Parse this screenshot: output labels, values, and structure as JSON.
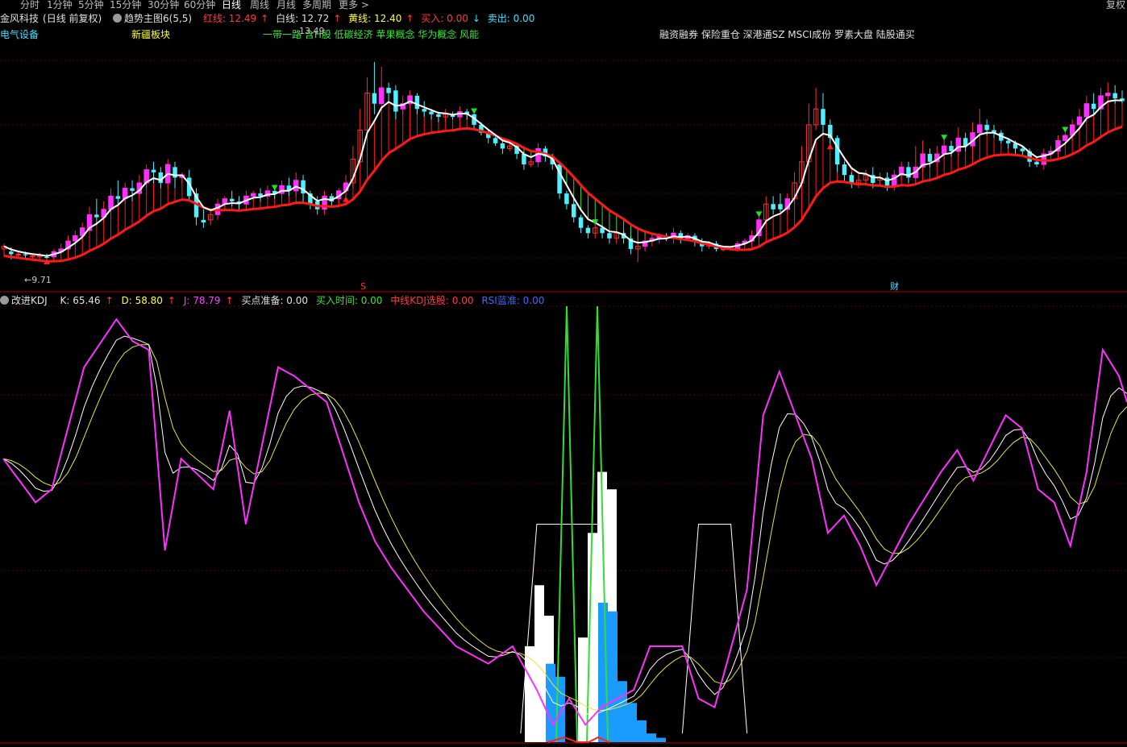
{
  "tabs": [
    "分时",
    "1分钟",
    "5分钟",
    "15分钟",
    "30分钟",
    "60分钟",
    "日线",
    "周线",
    "月线",
    "多周期",
    "更多 >"
  ],
  "active_tab": "日线",
  "corner_label": "复权",
  "stock": {
    "name": "金风科技",
    "mode": "(日线 前复权)"
  },
  "indicator1": {
    "name": "趋势主图6(5,5)",
    "red_label": "红线: 12.49",
    "white_label": "白线: 12.72",
    "yellow_label": "黄线: 12.40",
    "buy_label": "买入: 0.00",
    "sell_label": "卖出: 0.00"
  },
  "concepts": {
    "sector1": "电气设备",
    "sector2": "新疆板块",
    "themes": "一带一路 含H股 低碳经济 苹果概念 华为概念 风能",
    "themes2": "融资融券 保险重仓 深港通SZ MSCI成份 罗素大盘 陆股通买"
  },
  "chart_marks": {
    "low_label": "←9.71",
    "high_label": "13.49",
    "marker_s": "S",
    "marker_cai": "财"
  },
  "indicator2": {
    "name": "改进KDJ",
    "k_label": "K: 65.46",
    "d_label": "D: 58.80",
    "j_label": "J: 78.79",
    "prep_label": "买点准备: 0.00",
    "time_label": "买入时间: 0.00",
    "mid_label": "中线KDJ选股: 0.00",
    "rsi_label": "RSI蓝准: 0.00"
  },
  "colors": {
    "up": "#ff2d2d",
    "down": "#4ef0ff",
    "magenta": "#ff30ff",
    "red_line": "#ff1a1a",
    "white_line": "#ffffff",
    "green_fill": "#39d839",
    "blue_bar": "#1a9bff",
    "grid": "#5a0000"
  },
  "chart_data": {
    "type": "candlestick",
    "price_range": [
      9.4,
      13.9
    ],
    "candles": [
      [
        9.95,
        10.0,
        9.8,
        10.05
      ],
      [
        9.9,
        9.85,
        9.75,
        9.98
      ],
      [
        9.85,
        9.85,
        9.8,
        9.9
      ],
      [
        9.85,
        9.83,
        9.78,
        9.9
      ],
      [
        9.8,
        9.82,
        9.76,
        9.86
      ],
      [
        9.8,
        9.82,
        9.74,
        9.88
      ],
      [
        9.8,
        9.78,
        9.72,
        9.86
      ],
      [
        9.8,
        9.9,
        9.72,
        9.95
      ],
      [
        9.9,
        9.95,
        9.85,
        10.05
      ],
      [
        9.95,
        10.1,
        9.9,
        10.2
      ],
      [
        10.1,
        10.2,
        10.0,
        10.3
      ],
      [
        10.2,
        10.35,
        10.1,
        10.45
      ],
      [
        10.3,
        10.6,
        10.25,
        10.75
      ],
      [
        10.6,
        10.55,
        10.4,
        10.9
      ],
      [
        10.55,
        10.7,
        10.45,
        10.85
      ],
      [
        10.7,
        10.95,
        10.6,
        11.1
      ],
      [
        10.95,
        10.9,
        10.8,
        11.25
      ],
      [
        10.9,
        11.1,
        10.8,
        11.2
      ],
      [
        11.1,
        11.05,
        10.85,
        11.25
      ],
      [
        11.0,
        11.2,
        10.9,
        11.35
      ],
      [
        11.2,
        11.45,
        11.1,
        11.55
      ],
      [
        11.45,
        11.4,
        11.2,
        11.6
      ],
      [
        11.4,
        11.2,
        11.1,
        11.5
      ],
      [
        11.2,
        11.55,
        11.1,
        11.65
      ],
      [
        11.5,
        11.3,
        11.1,
        11.6
      ],
      [
        11.3,
        11.35,
        11.2,
        11.4
      ],
      [
        11.3,
        10.95,
        10.85,
        11.45
      ],
      [
        11.0,
        10.55,
        10.4,
        11.1
      ],
      [
        10.5,
        10.45,
        10.35,
        10.7
      ],
      [
        10.5,
        10.6,
        10.4,
        10.7
      ],
      [
        10.6,
        10.8,
        10.5,
        10.9
      ],
      [
        10.8,
        10.9,
        10.7,
        10.95
      ],
      [
        10.9,
        10.85,
        10.75,
        11.05
      ],
      [
        10.85,
        10.8,
        10.7,
        10.95
      ],
      [
        10.8,
        10.95,
        10.7,
        11.05
      ],
      [
        10.95,
        11.0,
        10.85,
        11.05
      ],
      [
        11.0,
        10.95,
        10.85,
        11.1
      ],
      [
        10.95,
        11.05,
        10.9,
        11.15
      ],
      [
        11.05,
        11.0,
        10.9,
        11.1
      ],
      [
        11.0,
        11.15,
        10.9,
        11.25
      ],
      [
        11.15,
        11.05,
        10.95,
        11.3
      ],
      [
        11.05,
        11.25,
        10.95,
        11.4
      ],
      [
        11.25,
        11.0,
        10.8,
        11.35
      ],
      [
        11.0,
        10.8,
        10.7,
        11.05
      ],
      [
        10.85,
        10.7,
        10.6,
        10.95
      ],
      [
        10.7,
        10.95,
        10.6,
        11.05
      ],
      [
        10.95,
        10.85,
        10.75,
        11.0
      ],
      [
        10.9,
        11.05,
        10.8,
        11.1
      ],
      [
        11.05,
        11.2,
        10.9,
        11.35
      ],
      [
        11.2,
        11.65,
        11.1,
        11.9
      ],
      [
        11.6,
        12.2,
        11.5,
        12.6
      ],
      [
        12.2,
        12.9,
        12.0,
        13.2
      ],
      [
        12.9,
        12.7,
        12.5,
        13.49
      ],
      [
        12.7,
        13.0,
        12.6,
        13.4
      ],
      [
        13.0,
        12.9,
        12.75,
        13.1
      ],
      [
        12.95,
        12.55,
        12.4,
        13.05
      ],
      [
        12.6,
        12.7,
        12.5,
        12.85
      ],
      [
        12.7,
        12.85,
        12.6,
        12.95
      ],
      [
        12.85,
        12.6,
        12.5,
        12.9
      ],
      [
        12.6,
        12.55,
        12.45,
        12.75
      ],
      [
        12.55,
        12.5,
        12.4,
        12.6
      ],
      [
        12.5,
        12.45,
        12.35,
        12.55
      ],
      [
        12.45,
        12.5,
        12.35,
        12.6
      ],
      [
        12.5,
        12.45,
        12.4,
        12.55
      ],
      [
        12.45,
        12.55,
        12.4,
        12.65
      ],
      [
        12.55,
        12.5,
        12.4,
        12.6
      ],
      [
        12.5,
        12.3,
        12.2,
        12.55
      ],
      [
        12.3,
        12.15,
        12.1,
        12.35
      ],
      [
        12.15,
        12.05,
        11.95,
        12.2
      ],
      [
        12.05,
        11.95,
        11.9,
        12.1
      ],
      [
        11.95,
        11.85,
        11.75,
        12.0
      ],
      [
        11.85,
        11.9,
        11.8,
        12.0
      ],
      [
        11.9,
        11.75,
        11.65,
        11.95
      ],
      [
        11.75,
        11.55,
        11.45,
        11.8
      ],
      [
        11.55,
        11.6,
        11.5,
        11.7
      ],
      [
        11.6,
        11.85,
        11.5,
        11.95
      ],
      [
        11.85,
        11.7,
        11.6,
        11.9
      ],
      [
        11.7,
        11.55,
        11.45,
        11.75
      ],
      [
        11.55,
        11.0,
        10.9,
        11.6
      ],
      [
        11.0,
        10.8,
        10.7,
        11.05
      ],
      [
        10.8,
        10.55,
        10.45,
        10.9
      ],
      [
        10.55,
        10.35,
        10.25,
        10.6
      ],
      [
        10.35,
        10.25,
        10.15,
        10.4
      ],
      [
        10.25,
        10.35,
        10.15,
        10.45
      ],
      [
        10.35,
        10.25,
        10.15,
        10.4
      ],
      [
        10.25,
        10.15,
        10.05,
        10.3
      ],
      [
        10.15,
        10.25,
        10.05,
        10.3
      ],
      [
        10.25,
        10.15,
        10.05,
        10.3
      ],
      [
        10.15,
        9.95,
        9.85,
        10.2
      ],
      [
        9.95,
        10.0,
        9.7,
        10.35
      ],
      [
        10.0,
        10.1,
        9.9,
        10.2
      ],
      [
        10.1,
        10.15,
        10.0,
        10.2
      ],
      [
        10.15,
        10.2,
        10.05,
        10.25
      ],
      [
        10.2,
        10.15,
        10.1,
        10.25
      ],
      [
        10.15,
        10.25,
        10.05,
        10.35
      ],
      [
        10.25,
        10.15,
        10.05,
        10.3
      ],
      [
        10.15,
        10.2,
        10.1,
        10.25
      ],
      [
        10.2,
        10.1,
        10.0,
        10.25
      ],
      [
        10.1,
        10.0,
        9.9,
        10.15
      ],
      [
        10.0,
        10.05,
        9.95,
        10.1
      ],
      [
        10.05,
        9.95,
        9.9,
        10.1
      ],
      [
        9.95,
        9.95,
        9.9,
        10.0
      ],
      [
        9.95,
        9.98,
        9.92,
        10.0
      ],
      [
        9.95,
        10.05,
        9.9,
        10.1
      ],
      [
        10.05,
        10.1,
        10.0,
        10.15
      ],
      [
        10.1,
        10.2,
        10.05,
        10.3
      ],
      [
        10.2,
        10.5,
        10.1,
        10.6
      ],
      [
        10.5,
        10.8,
        10.4,
        10.95
      ],
      [
        10.8,
        10.7,
        10.6,
        10.95
      ],
      [
        10.8,
        10.7,
        10.65,
        11.0
      ],
      [
        10.7,
        10.9,
        10.6,
        11.0
      ],
      [
        10.9,
        11.2,
        10.8,
        11.4
      ],
      [
        11.2,
        11.6,
        11.1,
        11.9
      ],
      [
        11.6,
        12.3,
        11.5,
        12.7
      ],
      [
        12.3,
        12.6,
        12.2,
        13.0
      ],
      [
        12.6,
        12.3,
        12.1,
        12.9
      ],
      [
        12.3,
        12.05,
        11.9,
        12.4
      ],
      [
        12.05,
        11.55,
        11.4,
        12.1
      ],
      [
        11.55,
        11.35,
        11.2,
        11.6
      ],
      [
        11.35,
        11.2,
        11.1,
        11.4
      ],
      [
        11.2,
        11.25,
        11.1,
        11.35
      ],
      [
        11.25,
        11.35,
        11.15,
        11.45
      ],
      [
        11.35,
        11.2,
        11.1,
        11.5
      ],
      [
        11.25,
        11.3,
        11.15,
        11.4
      ],
      [
        11.3,
        11.15,
        11.05,
        11.4
      ],
      [
        11.15,
        11.35,
        11.05,
        11.45
      ],
      [
        11.35,
        11.5,
        11.25,
        11.6
      ],
      [
        11.5,
        11.3,
        11.2,
        11.6
      ],
      [
        11.3,
        11.5,
        11.2,
        11.9
      ],
      [
        11.5,
        11.75,
        11.4,
        12.0
      ],
      [
        11.75,
        11.6,
        11.5,
        11.85
      ],
      [
        11.6,
        11.75,
        11.5,
        11.9
      ],
      [
        11.75,
        11.9,
        11.65,
        12.05
      ],
      [
        11.9,
        11.8,
        11.7,
        12.0
      ],
      [
        11.8,
        12.05,
        11.7,
        12.25
      ],
      [
        12.05,
        11.9,
        11.8,
        12.15
      ],
      [
        11.9,
        12.15,
        11.8,
        12.35
      ],
      [
        12.15,
        12.3,
        12.05,
        12.6
      ],
      [
        12.3,
        12.2,
        12.1,
        12.4
      ],
      [
        12.2,
        12.15,
        12.05,
        12.3
      ],
      [
        12.15,
        12.0,
        11.95,
        12.2
      ],
      [
        12.0,
        11.95,
        11.85,
        12.05
      ],
      [
        11.95,
        11.85,
        11.75,
        12.0
      ],
      [
        11.85,
        11.8,
        11.7,
        11.9
      ],
      [
        11.8,
        11.6,
        11.5,
        11.85
      ],
      [
        11.6,
        11.55,
        11.5,
        11.7
      ],
      [
        11.55,
        11.75,
        11.45,
        11.85
      ],
      [
        11.75,
        11.8,
        11.7,
        11.9
      ],
      [
        11.8,
        12.0,
        11.7,
        12.1
      ],
      [
        12.0,
        12.1,
        11.9,
        12.2
      ],
      [
        12.1,
        12.3,
        12.0,
        12.4
      ],
      [
        12.3,
        12.45,
        12.2,
        12.6
      ],
      [
        12.45,
        12.7,
        12.35,
        12.85
      ],
      [
        12.7,
        12.6,
        12.5,
        12.9
      ],
      [
        12.6,
        12.85,
        12.5,
        13.0
      ],
      [
        12.85,
        12.9,
        12.75,
        13.1
      ],
      [
        12.9,
        12.8,
        12.7,
        13.05
      ],
      [
        12.8,
        12.75,
        12.7,
        12.95
      ]
    ],
    "kdj": {
      "range": [
        0,
        100
      ]
    },
    "bars_white_heights": [
      0.22,
      0.36,
      0.29,
      0.24,
      0.48,
      0.62,
      0.58
    ],
    "bars_blue_heights": [
      0.18,
      0.15,
      0.32,
      0.3,
      0.14,
      0.09,
      0.05,
      0.02,
      0.01
    ]
  }
}
